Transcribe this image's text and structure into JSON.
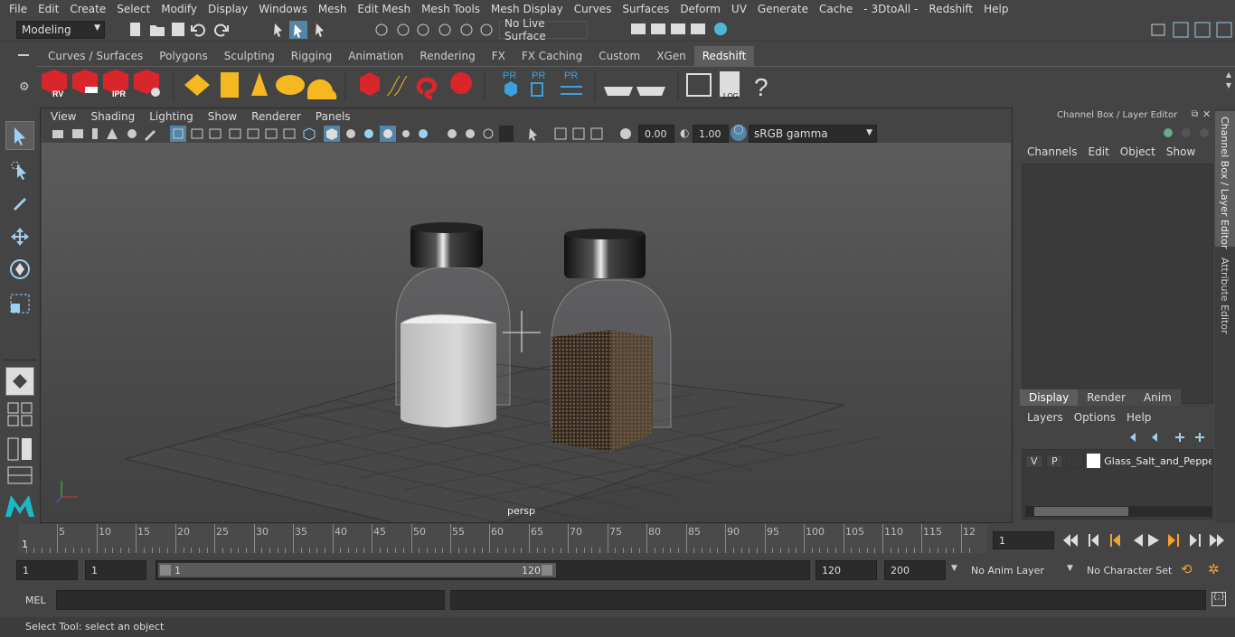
{
  "menu": [
    "File",
    "Edit",
    "Create",
    "Select",
    "Modify",
    "Display",
    "Windows",
    "Mesh",
    "Edit Mesh",
    "Mesh Tools",
    "Mesh Display",
    "Curves",
    "Surfaces",
    "Deform",
    "UV",
    "Generate",
    "Cache",
    "- 3DtoAll -",
    "Redshift",
    "Help"
  ],
  "workspace": "Modeling",
  "live_surface": "No Live Surface",
  "shelf_tabs": [
    "Curves / Surfaces",
    "Polygons",
    "Sculpting",
    "Rigging",
    "Animation",
    "Rendering",
    "FX",
    "FX Caching",
    "Custom",
    "XGen",
    "Redshift"
  ],
  "active_shelf": "Redshift",
  "shelf_labels": {
    "rv": "RV",
    "ipr": "IPR",
    "pr1": "PR",
    "pr2": "PR",
    "pr3": "PR",
    "log": "LOG",
    "help": "?"
  },
  "viewport": {
    "menu": [
      "View",
      "Shading",
      "Lighting",
      "Show",
      "Renderer",
      "Panels"
    ],
    "exposure": "0.00",
    "gamma": "1.00",
    "color_space": "sRGB gamma",
    "camera_label": "persp"
  },
  "channel_box": {
    "title": "Channel Box / Layer Editor",
    "menu": [
      "Channels",
      "Edit",
      "Object",
      "Show"
    ],
    "layer_tabs": [
      "Display",
      "Render",
      "Anim"
    ],
    "active_layer_tab": "Display",
    "layer_menu": [
      "Layers",
      "Options",
      "Help"
    ],
    "layer": {
      "v": "V",
      "p": "P",
      "name": "Glass_Salt_and_Peppe"
    }
  },
  "side_tabs": [
    "Channel Box / Layer Editor",
    "Attribute Editor"
  ],
  "timeline": {
    "labels": [
      "5",
      "10",
      "15",
      "20",
      "25",
      "30",
      "35",
      "40",
      "45",
      "50",
      "55",
      "60",
      "65",
      "70",
      "75",
      "80",
      "85",
      "90",
      "95",
      "100",
      "105",
      "110",
      "115",
      "12"
    ],
    "start_marker": "1",
    "current_frame": "1"
  },
  "range": {
    "start": "1",
    "playback_start": "1",
    "slider_start": "1",
    "slider_end": "120",
    "playback_end": "120",
    "end": "200",
    "anim_layer": "No Anim Layer",
    "character_set": "No Character Set"
  },
  "command": {
    "lang": "MEL"
  },
  "help_line": "Select Tool: select an object",
  "colors": {
    "accent": "#5285a6",
    "redshift_red": "#d9262b",
    "gold": "#f5b820",
    "pr_blue": "#3aa0e0"
  }
}
